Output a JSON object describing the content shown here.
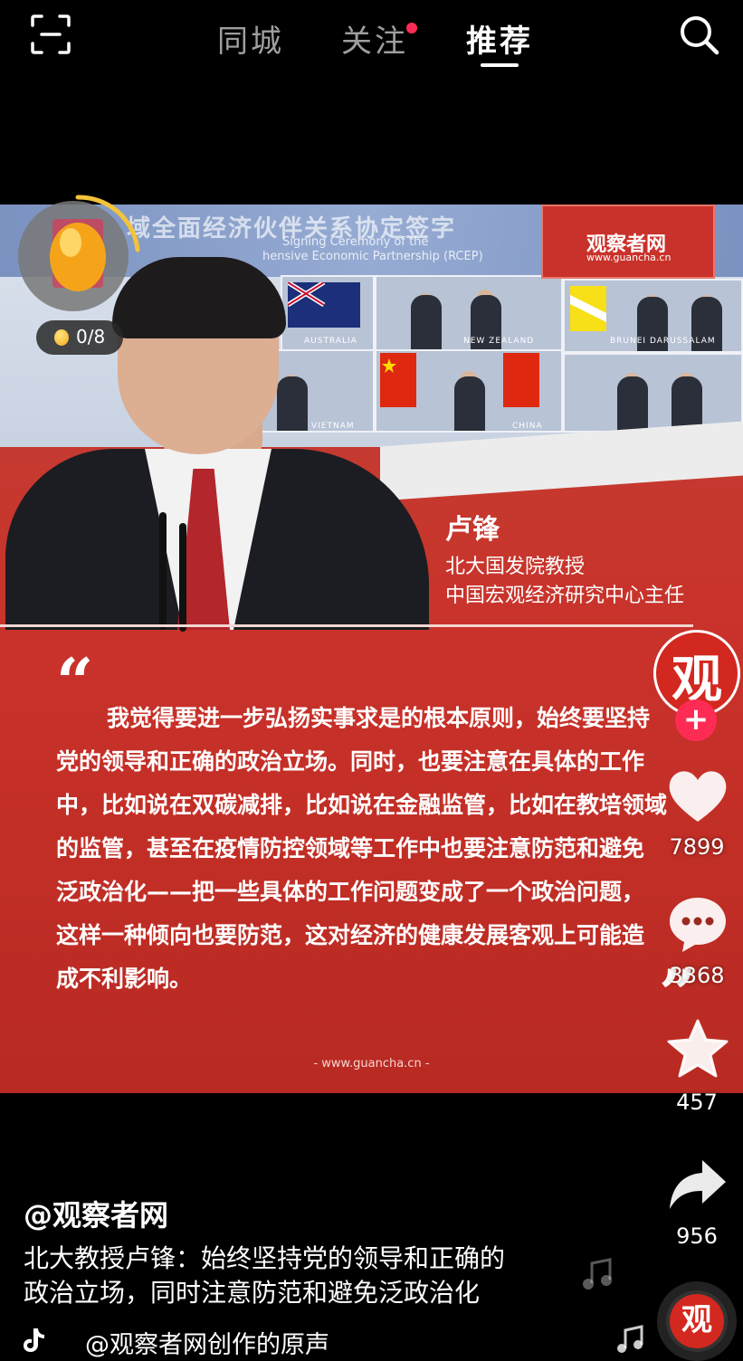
{
  "top_nav": {
    "tabs": [
      {
        "label": "同城"
      },
      {
        "label": "关注"
      },
      {
        "label": "推荐"
      }
    ],
    "active_tab": "推荐"
  },
  "video": {
    "banner_title": "域全面经济伙伴关系协定签字",
    "banner_sub1": "Signing Ceremony of the",
    "banner_sub2": "hensive Economic Partnership (RCEP)",
    "countries": [
      "AUSTRALIA",
      "NEW ZEALAND",
      "BRUNEI DARUSSALAM",
      "VIETNAM",
      "CHINA"
    ],
    "logo_cn": "观察者网",
    "logo_url": "www.guancha.cn",
    "speaker_name": "卢锋",
    "speaker_title1": "北大国发院教授",
    "speaker_title2": "中国宏观经济研究中心主任",
    "quote_open": "“",
    "quote_close": "”",
    "quote_lines": [
      "我觉得要进一步弘扬实事求是的根本原则，始终要坚持",
      "党的领导和正确的政治立场。同时，也要注意在具体的工作",
      "中，比如说在双碳减排，比如说在金融监管，比如在教培领域",
      "的监管，甚至在疫情防控领域等工作中也要注意防范和避免",
      "泛政治化——把一些具体的工作问题变成了一个政治问题，",
      "这样一种倾向也要防范，这对经济的健康发展客观上可能造",
      "成不利影响。"
    ],
    "url_footer": "- www.guancha.cn -"
  },
  "coin_widget": {
    "progress_text": "0/8",
    "progress_fraction": 0.25
  },
  "avatar_glyph": "观",
  "follow_symbol": "+",
  "actions": {
    "likes": "7899",
    "comments": "3368",
    "favorites": "457",
    "shares": "956"
  },
  "post": {
    "author": "@观察者网",
    "caption_line1": "北大教授卢锋：始终坚持党的领导和正确的",
    "caption_line2": "政治立场，同时注意防范和避免泛政治化",
    "music": "@观察者网创作的原声"
  },
  "colors": {
    "accent": "#fe2c55",
    "video_red": "#c9322a"
  }
}
